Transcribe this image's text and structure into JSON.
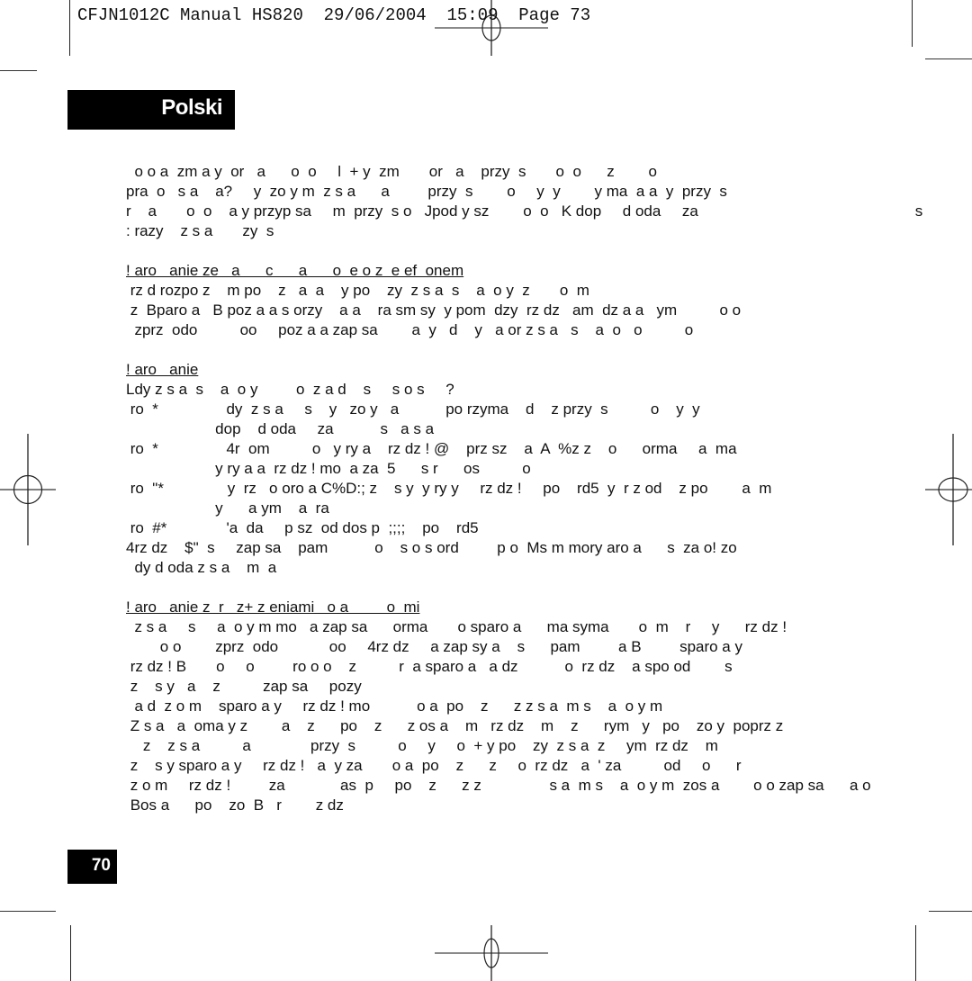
{
  "slug": "CFJN1012C Manual HS820  29/06/2004  15:09  Page 73",
  "language_tab": "Polski",
  "page_number": "70",
  "paragraphs": [
    {
      "heading": "",
      "lines": [
        "  o o a  zm a y  or   a      o  o     l  + y  zm       or   a    przy  s       o  o      z        o",
        "pra  o   s a    a?     y  zo y m  z s a      a         przy  s        o     y  y        y ma  a a  y  przy  s",
        "r    a       o  o    a y przyp sa     m  przy  s o   Jpod y sz        o  o   K dop     d oda     za                                                   s",
        ": razy    z s a       zy  s"
      ]
    },
    {
      "heading": "! aro   anie ze   a      c      a      o  e o z  e ef  onem",
      "lines": [
        " rz d rozpo z    m po    z   a  a    y po    zy  z s a  s    a  o y  z       o  m",
        " z  Bparo a   B poz a a s orzy    a a    ra sm sy  y pom  dzy  rz dz   am  dz a a   ym          o o",
        "  zprz  odo          oo     poz a a zap sa        a  y   d    y   a or z s a   s    a  o   o          o"
      ]
    },
    {
      "heading": "! aro   anie",
      "lines": [
        "Ldy z s a  s    a  o y         o  z a d    s     s o s     ?",
        " ro  *                dy  z s a     s    y   zo y   a           po rzyma    d    z przy  s          o    y  y",
        "                     dop    d oda     za           s   a s a",
        " ro  *                4r  om          o   y ry a    rz dz ! @    prz sz    a  A  %z z    o      orma     a  ma",
        "                     y ry a a  rz dz ! mo  a za  5      s r      os          o",
        " ro  \"*               y  rz   o oro a C%D:; z    s y  y ry y     rz dz !     po    rd5  y  r z od    z po        a  m",
        "                     y      a ym    a  ra",
        " ro  #*              'a  da     p sz  od dos p  ;;;;    po    rd5",
        "4rz dz    $\"  s     zap sa    pam           o    s o s ord         p o  Ms m mory aro a      s  za o! zo",
        "  dy d oda z s a    m  a"
      ]
    },
    {
      "heading": "! aro   anie z  r   z+ z eniami   o a         o  mi",
      "lines": [
        "  z s a     s     a  o y m mo   a zap sa      orma       o sparo a      ma syma       o  m    r     y      rz dz !",
        "        o o        zprz  odo            oo     4rz dz     a zap sy a    s      pam         a B         sparo a y",
        " rz dz ! B       o     o         ro o o    z          r  a sparo a   a dz           o  rz dz    a spo od        s",
        " z    s y   a    z          zap sa     pozy",
        "  a d  z o m    sparo a y     rz dz ! mo           o a  po    z      z z s a  m s    a  o y m",
        " Z s a   a  oma y z        a    z      po    z      z os a    m   rz dz    m    z      rym   y   po    zo y  poprz z",
        "    z    z s a          a              przy  s          o     y     o  + y po    zy  z s a  z     ym  rz dz    m",
        " z    s y sparo a y     rz dz !   a  y za       o a  po    z      z     o  rz dz   a  ' za          od     o      r",
        " z o m     rz dz !         za             as  p     po    z      z z                s a  m s    a  o y m  zos a        o o zap sa      a o",
        " Bos a      po    zo  B   r        z dz"
      ]
    }
  ]
}
